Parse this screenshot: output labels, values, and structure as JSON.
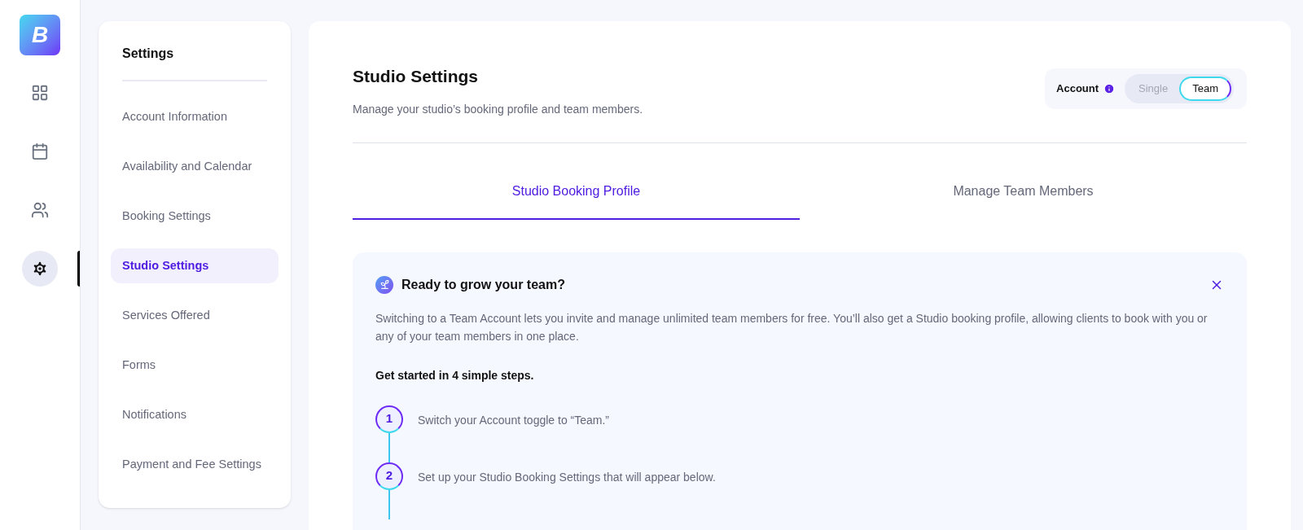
{
  "logo": {
    "letter": "B"
  },
  "rail": [
    {
      "kind": "grid",
      "selected": false
    },
    {
      "kind": "calendar",
      "selected": false
    },
    {
      "kind": "users",
      "selected": false
    },
    {
      "kind": "gear",
      "selected": true
    }
  ],
  "settings_menu": {
    "title": "Settings",
    "items": [
      {
        "label": "Account Information",
        "selected": false
      },
      {
        "label": "Availability and Calendar",
        "selected": false
      },
      {
        "label": "Booking Settings",
        "selected": false
      },
      {
        "label": "Studio Settings",
        "selected": true
      },
      {
        "label": "Services Offered",
        "selected": false
      },
      {
        "label": "Forms",
        "selected": false
      },
      {
        "label": "Notifications",
        "selected": false
      },
      {
        "label": "Payment and Fee Settings",
        "selected": false
      }
    ]
  },
  "page": {
    "title": "Studio Settings",
    "subtitle": "Manage your studio’s booking profile and team members."
  },
  "account_toggle": {
    "label": "Account",
    "options": [
      {
        "label": "Single",
        "selected": false
      },
      {
        "label": "Team",
        "selected": true
      }
    ]
  },
  "tabs": [
    {
      "label": "Studio Booking Profile",
      "selected": true
    },
    {
      "label": "Manage Team Members",
      "selected": false
    }
  ],
  "banner": {
    "title": "Ready to grow your team?",
    "text": "Switching to a Team Account lets you invite and manage unlimited team members for free. You’ll also get a Studio booking profile, allowing clients to book with you or any of your team members in one place.",
    "steps_heading": "Get started in 4 simple steps.",
    "steps": [
      {
        "number": "1",
        "text": "Switch your Account toggle to “Team.”"
      },
      {
        "number": "2",
        "text": "Set up your Studio Booking Settings that will appear below."
      }
    ]
  }
}
